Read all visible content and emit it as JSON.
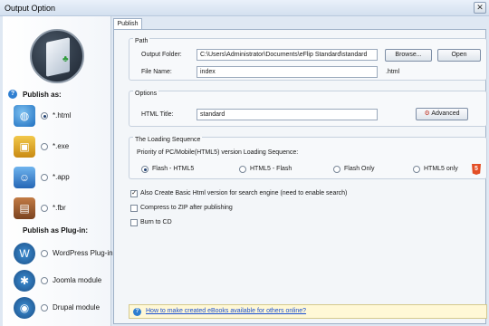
{
  "window": {
    "title": "Output Option",
    "close_glyph": "✕"
  },
  "sidebar": {
    "publish_as_label": "Publish as:",
    "formats": [
      {
        "label": "*.html",
        "icon": "globe-icon",
        "selected": true
      },
      {
        "label": "*.exe",
        "icon": "lock-icon",
        "selected": false
      },
      {
        "label": "*.app",
        "icon": "mac-finder-icon",
        "selected": false
      },
      {
        "label": "*.fbr",
        "icon": "book-icon",
        "selected": false
      }
    ],
    "plugin_label": "Publish as Plug-in:",
    "plugins": [
      {
        "label": "WordPress Plug-in",
        "icon": "wordpress-icon",
        "selected": false
      },
      {
        "label": "Joomla module",
        "icon": "joomla-icon",
        "selected": false
      },
      {
        "label": "Drupal module",
        "icon": "drupal-icon",
        "selected": false
      }
    ]
  },
  "tab": {
    "label": "Publish"
  },
  "path": {
    "title": "Path",
    "output_folder_label": "Output Folder:",
    "output_folder_value": "C:\\Users\\Administrator\\Documents\\eFlip Standard\\standard",
    "browse_label": "Browse...",
    "open_label": "Open",
    "file_name_label": "File Name:",
    "file_name_value": "index",
    "extension": ".html"
  },
  "options": {
    "title": "Options",
    "html_title_label": "HTML Title:",
    "html_title_value": "standard",
    "advanced_label": "Advanced"
  },
  "loading": {
    "title": "The Loading Sequence",
    "priority_label": "Priority of PC/Mobile(HTML5) version Loading Sequence:",
    "choices": [
      {
        "label": "Flash - HTML5",
        "selected": true
      },
      {
        "label": "HTML5 - Flash",
        "selected": false
      },
      {
        "label": "Flash Only",
        "selected": false
      },
      {
        "label": "HTML5 only",
        "selected": false
      }
    ],
    "html5_badge": "5"
  },
  "checkboxes": [
    {
      "label": "Also Create Basic Html version for search engine (need to enable search)",
      "checked": true
    },
    {
      "label": "Compress to ZIP after publishing",
      "checked": false
    },
    {
      "label": "Burn to CD",
      "checked": false
    }
  ],
  "help_link": {
    "label": "How to make created eBooks available for others online?"
  },
  "colors": {
    "accent": "#2f7fd1",
    "link": "#1a4fd0",
    "html5": "#e34f26"
  }
}
